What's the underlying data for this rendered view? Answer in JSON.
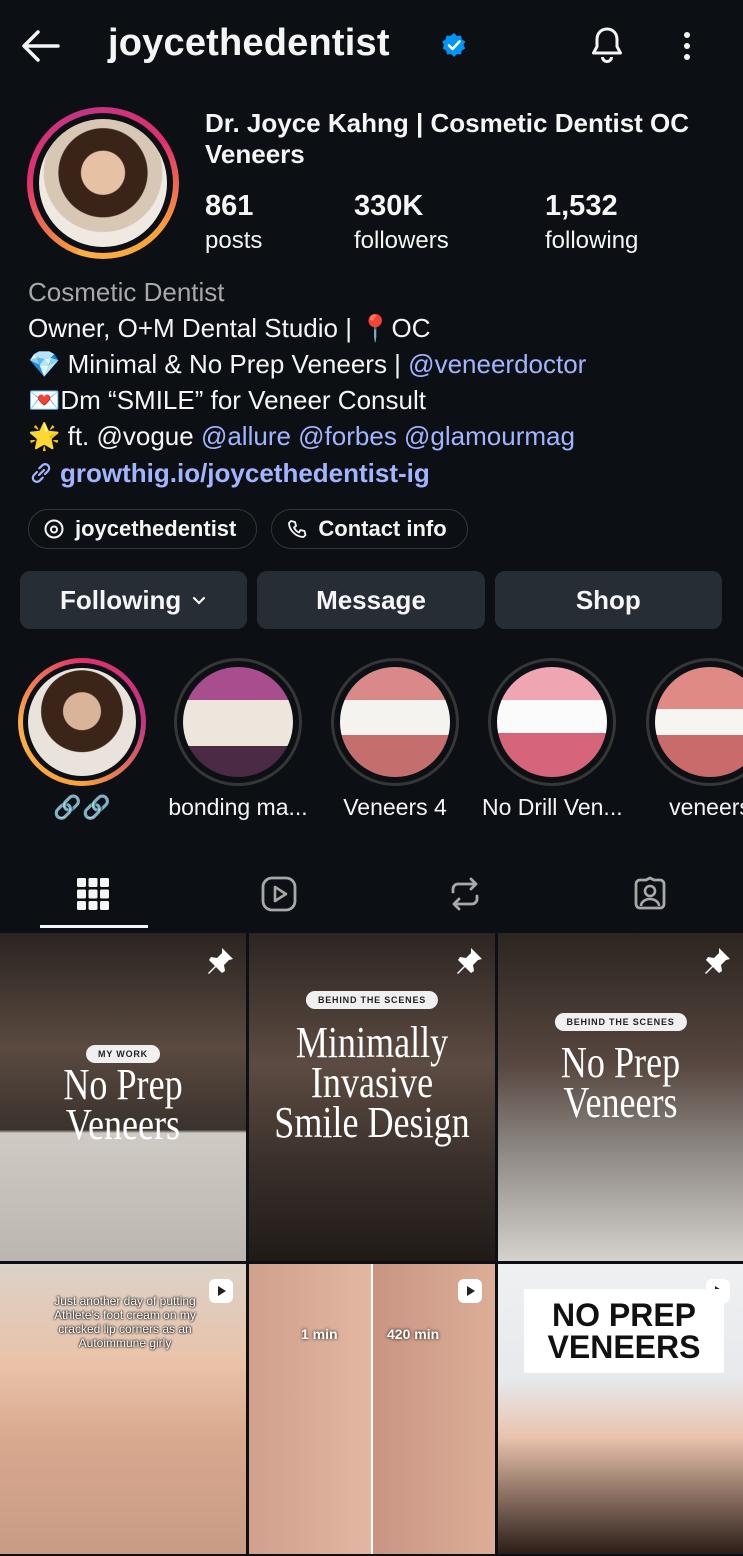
{
  "header": {
    "username": "joycethedentist",
    "verified": true,
    "icons": [
      "back-arrow-icon",
      "verified-badge-icon",
      "bell-icon",
      "more-vertical-icon"
    ]
  },
  "profile": {
    "display_name": "Dr. Joyce Kahng | Cosmetic Dentist OC Veneers",
    "stats": [
      {
        "num": "861",
        "label": "posts"
      },
      {
        "num": "330K",
        "label": "followers"
      },
      {
        "num": "1,532",
        "label": "following"
      }
    ],
    "category": "Cosmetic Dentist",
    "bio_line1": "Owner, O+M Dental Studio | 📍OC",
    "bio_line2_text": "💎 Minimal & No Prep Veneers | ",
    "bio_line2_mention": "@veneerdoctor",
    "bio_line3": "💌Dm “SMILE” for Veneer Consult",
    "bio_line4_prefix": "🌟 ft. @vogue ",
    "bio_line4_mentions": "@allure @forbes @glamourmag",
    "link": "growthig.io/joycethedentist-ig"
  },
  "chips": {
    "threads": "joycethedentist",
    "contact": "Contact info"
  },
  "actions": {
    "following": "Following",
    "message": "Message",
    "shop": "Shop"
  },
  "highlights": [
    {
      "label": "🔗🔗"
    },
    {
      "label": "bonding ma..."
    },
    {
      "label": "Veneers 4"
    },
    {
      "label": "No Drill Ven..."
    },
    {
      "label": "veneers"
    }
  ],
  "tabs": [
    "grid-icon",
    "reels-icon",
    "reposts-icon",
    "tagged-icon"
  ],
  "posts": [
    {
      "pill": "MY WORK",
      "title": "No Prep Veneers",
      "pinned": true
    },
    {
      "pill": "BEHIND THE SCENES",
      "title": "Minimally Invasive Smile Design",
      "pinned": true
    },
    {
      "pill": "BEHIND THE SCENES",
      "title": "No Prep Veneers",
      "pinned": true
    },
    {
      "caption": "Just another day of putting Athlete's foot cream on my cracked lip corners as an Autoimmune girly",
      "reel": true
    },
    {
      "left_label": "1 min",
      "right_label": "420 min",
      "reel": true
    },
    {
      "title": "NO PREP VENEERS",
      "reel": true
    }
  ],
  "colors": {
    "background": "#0c1014",
    "button": "#262d34",
    "link": "#a3b4ff",
    "verified": "#0095f6"
  }
}
